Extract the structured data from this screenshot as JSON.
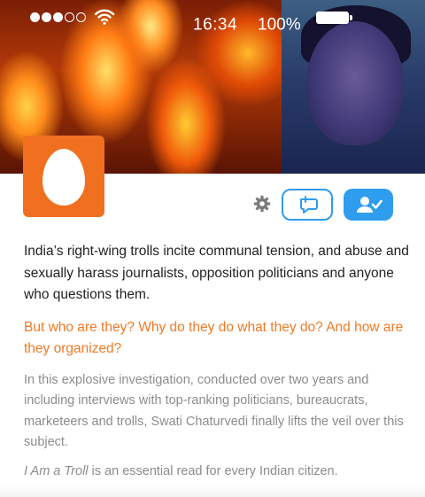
{
  "status_bar": {
    "signal_filled": 3,
    "signal_total": 5,
    "time": "16:34",
    "battery_percent": "100%",
    "icons": [
      "signal-dots-icon",
      "wifi-icon",
      "battery-icon"
    ]
  },
  "profile": {
    "avatar_icon": "egg-avatar-icon",
    "actions": {
      "settings_icon": "gear-icon",
      "tweet_to_icon": "compose-tweet-icon",
      "follow_icon": "follow-person-icon"
    }
  },
  "text": {
    "intro": "India’s right-wing trolls incite communal tension, and abuse and sexually harass journalists, opposition politicians and anyone who questions them.",
    "questions": "But who are they? Why do they do what they do? And how are they organized?",
    "investigation": "In this explosive investigation, conducted over two years and including interviews with top-ranking politicians, bureaucrats, marketeers and trolls, Swati Chaturvedi finally lifts the veil over this subject.",
    "closing_title": "I Am a Troll",
    "closing_rest": " is an essential read for every Indian citizen."
  },
  "colors": {
    "accent_orange": "#f07a25",
    "twitter_blue": "#2f9ded",
    "avatar_orange": "#f07020",
    "body_text": "#222222",
    "muted_text": "#8c8c8c"
  }
}
